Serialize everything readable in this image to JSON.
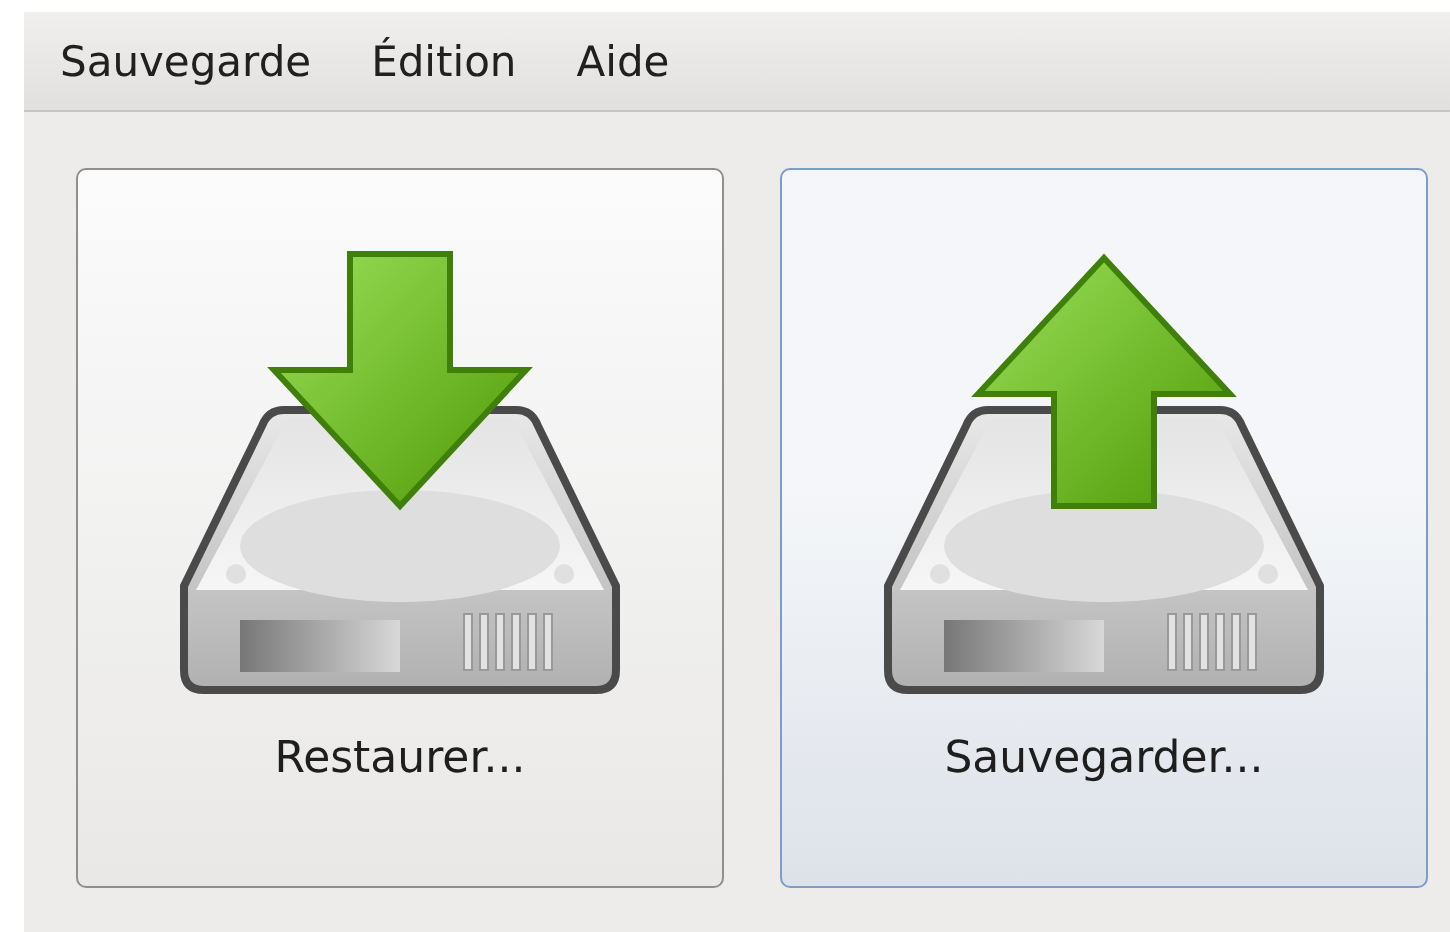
{
  "menu_bar": {
    "items": [
      "Sauvegarde",
      "Édition",
      "Aide"
    ]
  },
  "actions": [
    {
      "label": "Restaurer...",
      "kind": "down",
      "highlighted": false
    },
    {
      "label": "Sauvegarder...",
      "kind": "up",
      "highlighted": true
    }
  ]
}
